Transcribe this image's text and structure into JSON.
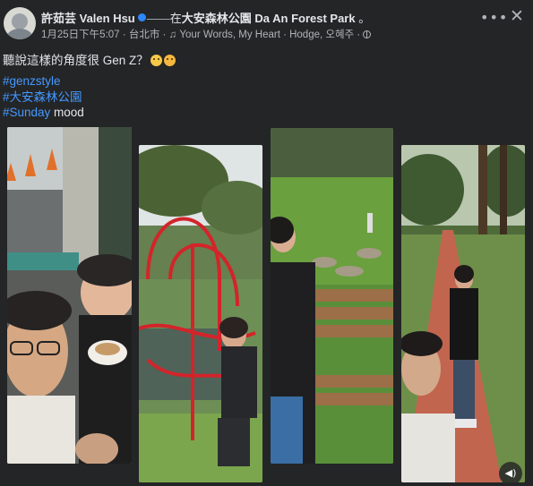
{
  "header": {
    "author": "許茹芸 Valen Hsu",
    "connector": "在",
    "place": "大安森林公園 Da An Forest Park",
    "trailing": "。"
  },
  "meta": {
    "date": "1月25日下午5:07",
    "separator1": "·",
    "city": "台北市",
    "separator2": "·",
    "music_note": "♫",
    "song": "Your Words, My Heart · Hodge, 오혜주",
    "separator3": "·"
  },
  "post": {
    "text": "聽說這樣的角度很 Gen Z？",
    "hashtags": [
      "#genzstyle",
      "#大安森林公園",
      "#Sunday"
    ],
    "mood": " mood"
  },
  "icons": {
    "more": "more-options-icon",
    "close": "close-icon",
    "privacy": "globe-icon",
    "play": "video-play-icon",
    "accent": "#4599ff"
  },
  "photos": [
    {
      "label": "bus selfie"
    },
    {
      "label": "red playground"
    },
    {
      "label": "bench pond"
    },
    {
      "label": "forest path"
    }
  ]
}
